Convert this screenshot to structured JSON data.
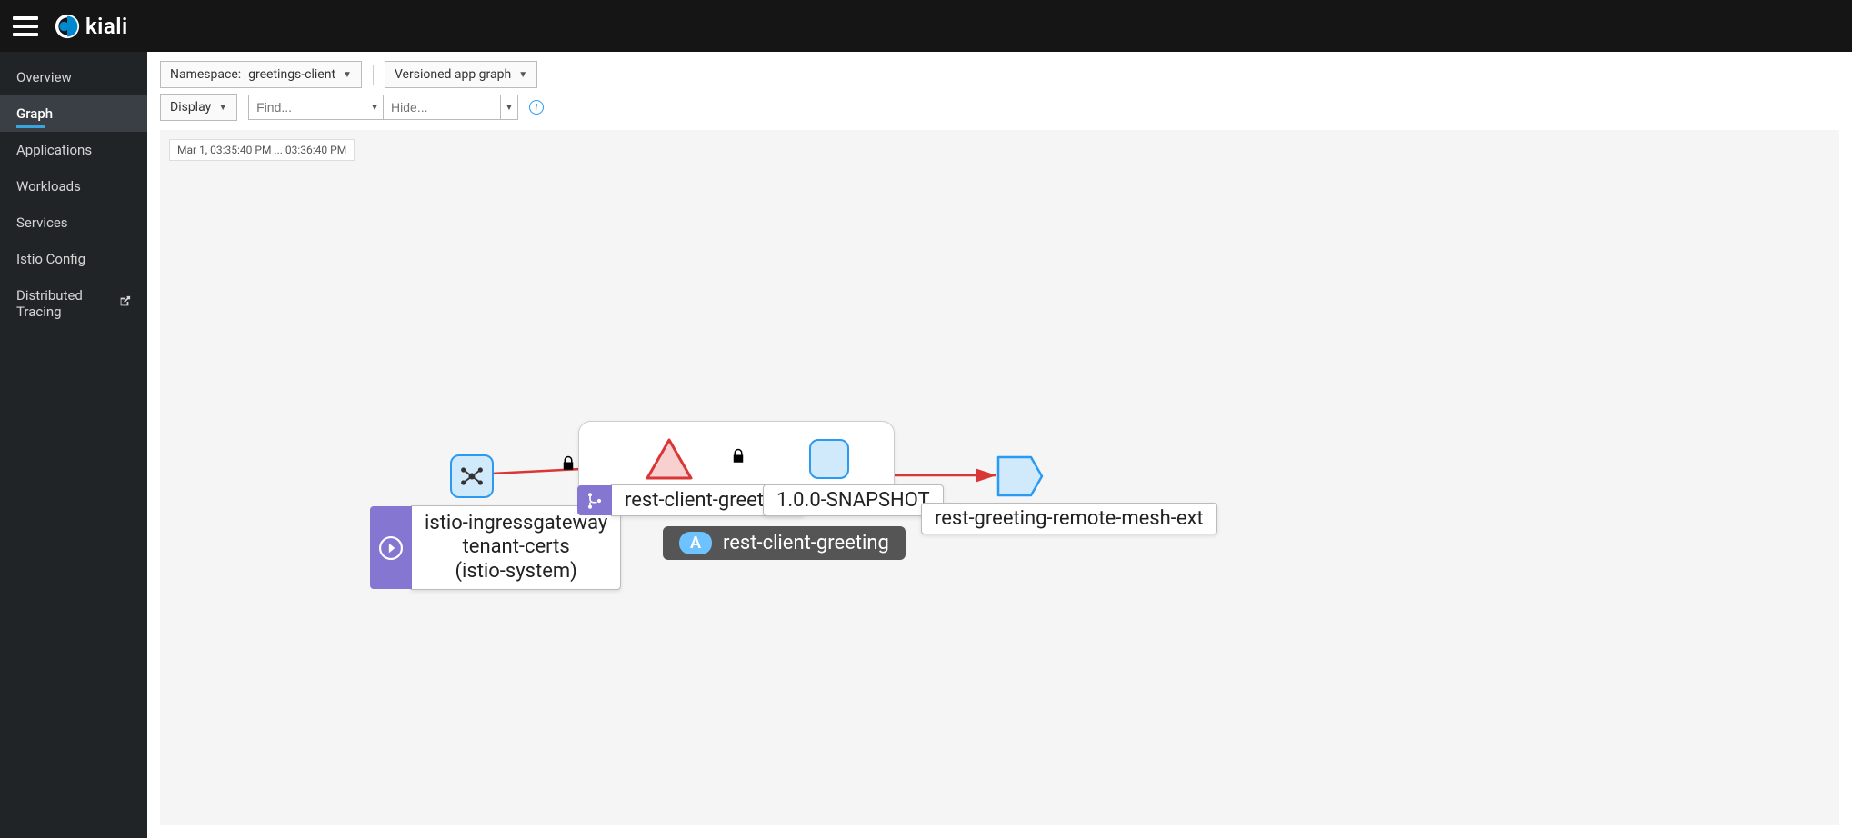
{
  "app": {
    "name": "kiali"
  },
  "sidebar": {
    "items": [
      {
        "label": "Overview"
      },
      {
        "label": "Graph"
      },
      {
        "label": "Applications"
      },
      {
        "label": "Workloads"
      },
      {
        "label": "Services"
      },
      {
        "label": "Istio Config"
      },
      {
        "label": "Distributed Tracing"
      }
    ],
    "active_index": 1
  },
  "toolbar": {
    "namespace_label": "Namespace:",
    "namespace_value": "greetings-client",
    "graph_type": "Versioned app graph",
    "display_label": "Display",
    "find_placeholder": "Find...",
    "hide_placeholder": "Hide..."
  },
  "canvas": {
    "time_range": "Mar 1, 03:35:40 PM ... 03:36:40 PM"
  },
  "graph": {
    "ingress": {
      "line1": "istio-ingressgateway",
      "line2": "tenant-certs",
      "line3": "(istio-system)"
    },
    "group": {
      "app_badge": "A",
      "app_name": "rest-client-greeting",
      "service_label": "rest-client-greeting",
      "workload_label": "1.0.0-SNAPSHOT"
    },
    "external": {
      "label": "rest-greeting-remote-mesh-ext"
    }
  }
}
